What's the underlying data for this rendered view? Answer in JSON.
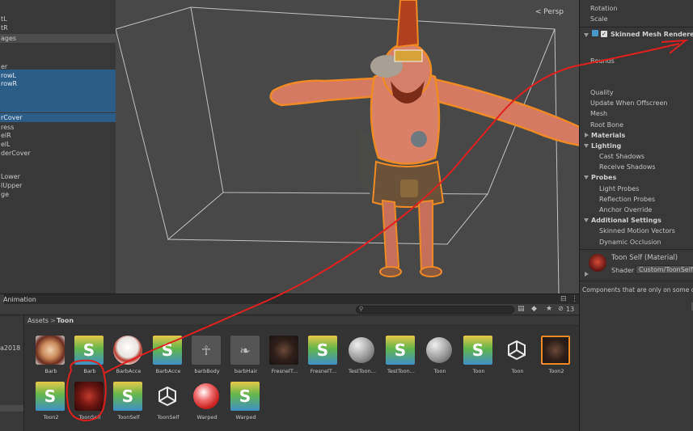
{
  "hierarchy": {
    "rows": [
      "tL",
      "tR",
      "ages",
      "",
      "",
      "er",
      "rowL",
      "rowR",
      "",
      "",
      "",
      "rCover",
      "ress",
      "elR",
      "elL",
      "derCover",
      "",
      "Lower",
      "lUpper",
      "ge"
    ]
  },
  "scene": {
    "persp_label": "< Persp"
  },
  "inspector": {
    "rotation": "Rotation",
    "scale": "Scale",
    "component_title": "Skinned Mesh Renderer",
    "bounds": "Bounds",
    "quality": "Quality",
    "update_offscreen": "Update When Offscreen",
    "mesh": "Mesh",
    "root_bone": "Root Bone",
    "materials": "Materials",
    "lighting": "Lighting",
    "cast_shadows": "Cast Shadows",
    "receive_shadows": "Receive Shadows",
    "probes": "Probes",
    "light_probes": "Light Probes",
    "reflection_probes": "Reflection Probes",
    "anchor_override": "Anchor Override",
    "additional_settings": "Additional Settings",
    "skinned_motion_vectors": "Skinned Motion Vectors",
    "dynamic_occlusion": "Dynamic Occlusion",
    "material_name": "Toon Self (Material)",
    "shader_label": "Shader",
    "shader_value": "Custom/ToonSelf",
    "footer": "Components that are only on some of"
  },
  "bottom": {
    "animation_tab": "Animation",
    "search_placeholder": "",
    "hidden_count": "13",
    "left_label": "a2018",
    "breadcrumb_root": "Assets",
    "breadcrumb_sep": ">",
    "breadcrumb_current": "Toon"
  },
  "assets": [
    {
      "label": "Barb",
      "kind": "tex1"
    },
    {
      "label": "Barb",
      "kind": "shader"
    },
    {
      "label": "BarbAcce",
      "kind": "tex2"
    },
    {
      "label": "BarbAcce",
      "kind": "shader"
    },
    {
      "label": "barbBody",
      "kind": "mesh"
    },
    {
      "label": "barbHair",
      "kind": "hair"
    },
    {
      "label": "FresnelT...",
      "kind": "darkchar"
    },
    {
      "label": "FresnelT...",
      "kind": "shader"
    },
    {
      "label": "TestToon...",
      "kind": "sphere"
    },
    {
      "label": "TestToon...",
      "kind": "shader"
    },
    {
      "label": "Toon",
      "kind": "sphere"
    },
    {
      "label": "Toon",
      "kind": "shader"
    },
    {
      "label": "Toon",
      "kind": "unity"
    },
    {
      "label": "Toon2",
      "kind": "darkchar2"
    },
    {
      "label": "Toon2",
      "kind": "shader"
    },
    {
      "label": "ToonSelf",
      "kind": "redtex"
    },
    {
      "label": "ToonSelf",
      "kind": "shader"
    },
    {
      "label": "ToonSelf",
      "kind": "unity"
    },
    {
      "label": "Warped",
      "kind": "warped"
    },
    {
      "label": "Warped",
      "kind": "shader"
    }
  ],
  "colors": {
    "selection": "#2c5d87",
    "annotation_red": "#e0201e",
    "outline_orange": "#f08a24"
  }
}
